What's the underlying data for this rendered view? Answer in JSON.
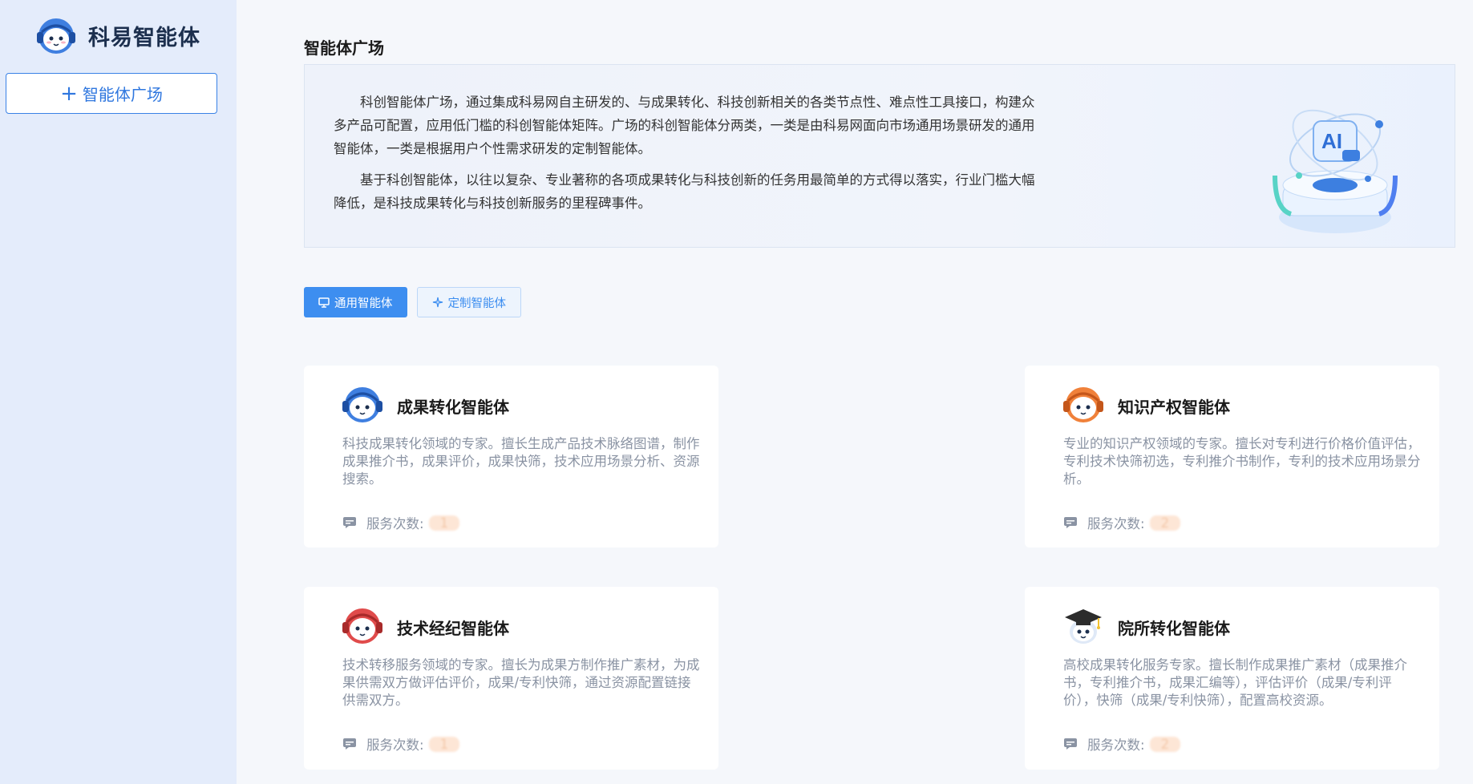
{
  "brand": {
    "name": "科易智能体",
    "logo_icon": "robot-headset-icon"
  },
  "sidebar": {
    "new_button_label": "智能体广场"
  },
  "page": {
    "title": "智能体广场",
    "intro_p1": "科创智能体广场，通过集成科易网自主研发的、与成果转化、科技创新相关的各类节点性、难点性工具接口，构建众多产品可配置，应用低门槛的科创智能体矩阵。广场的科创智能体分两类，一类是由科易网面向市场通用场景研发的通用智能体，一类是根据用户个性需求研发的定制智能体。",
    "intro_p2": "基于科创智能体，以往以复杂、专业著称的各项成果转化与科技创新的任务用最简单的方式得以落实，行业门槛大幅降低，是科技成果转化与科技创新服务的里程碑事件。"
  },
  "tabs": [
    {
      "label": "通用智能体",
      "icon": "monitor-icon",
      "active": true
    },
    {
      "label": "定制智能体",
      "icon": "sparkle-icon",
      "active": false
    }
  ],
  "cards": [
    {
      "name": "成果转化智能体",
      "desc": "科技成果转化领域的专家。擅长生成产品技术脉络图谱，制作成果推介书，成果评价，成果快筛，技术应用场景分析、资源搜索。",
      "stat_label": "服务次数:",
      "stat_value": "1",
      "avatar_color": "#3f7fe0"
    },
    {
      "name": "知识产权智能体",
      "desc": "专业的知识产权领域的专家。擅长对专利进行价格价值评估，专利技术快筛初选，专利推介书制作，专利的技术应用场景分析。",
      "stat_label": "服务次数:",
      "stat_value": "2",
      "avatar_color": "#f0813a"
    },
    {
      "name": "技术经纪智能体",
      "desc": "技术转移服务领域的专家。擅长为成果方制作推广素材，为成果供需双方做评估评价，成果/专利快筛，通过资源配置链接供需双方。",
      "stat_label": "服务次数:",
      "stat_value": "1",
      "avatar_color": "#e04b4b"
    },
    {
      "name": "院所转化智能体",
      "desc": "高校成果转化服务专家。擅长制作成果推广素材（成果推介书，专利推介书，成果汇编等），评估评价（成果/专利评价），快筛（成果/专利快筛），配置高校资源。",
      "stat_label": "服务次数:",
      "stat_value": "2",
      "avatar_color": "#2c2c2c"
    }
  ],
  "colors": {
    "accent": "#3d8ef0",
    "sidebar_bg": "#e4ecfb"
  }
}
